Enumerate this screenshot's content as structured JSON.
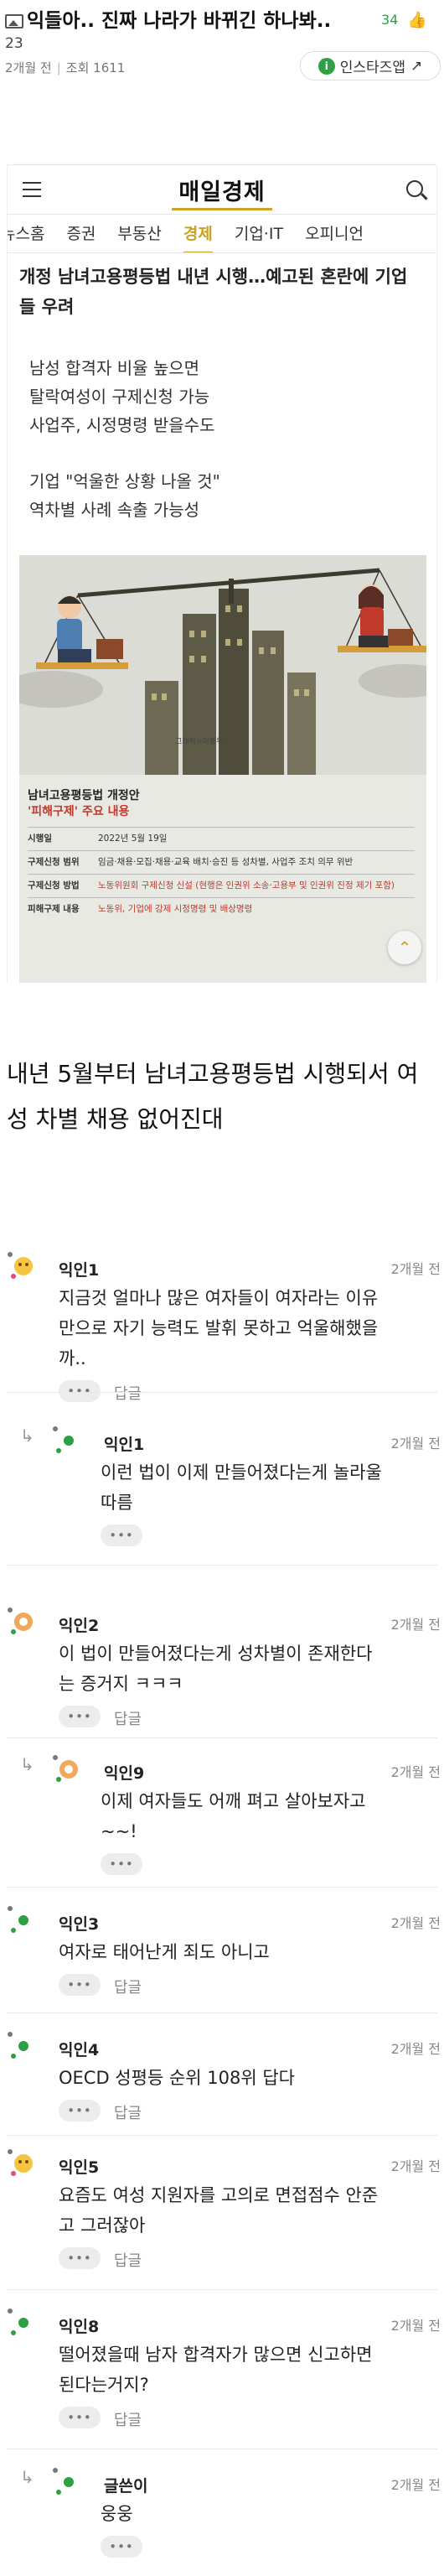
{
  "post": {
    "title": "익들아.. 진짜 나라가 바뀌긴 하나봐..",
    "like_count": "34",
    "comment_count": "23",
    "time_ago": "2개월 전",
    "views_label": "조회",
    "views": "1611",
    "insta_button": "인스타즈앱",
    "body": "내년 5월부터 남녀고용평등법 시행되서 여성 차별 채용 없어진대"
  },
  "article": {
    "logo": "매일경제",
    "nav_tabs": [
      "뉴스홈",
      "증권",
      "부동산",
      "경제",
      "기업·IT",
      "오피니언"
    ],
    "active_tab": "경제",
    "headline": "개정 남녀고용평등법 내년 시행…예고된 혼란에 기업들 우려",
    "sub1": [
      "남성 합격자 비율 높으면",
      "탈락여성이 구제신청 가능",
      "사업주, 시정명령 받을수도"
    ],
    "sub2": [
      "기업 \"억울한 상황 나올 것\"",
      "역차별 사례 속출 가능성"
    ],
    "illustration": {
      "credit": "그래픽=이충우",
      "box_title_1": "남녀고용평등법 개정안",
      "box_title_2": "'피해구제' 주요 내용",
      "rows": [
        {
          "k": "시행일",
          "v": "2022년 5월 19일"
        },
        {
          "k": "구제신청 범위",
          "v": "임금·채용·모집·채용·교육 배치·승진 등 성차별, 사업주 조치 의무 위반"
        },
        {
          "k": "구제신청 방법",
          "v": "노동위원회 구제신청 신설 (현행은 인권위 소송·고용부 및 인권위 진정 제기 포함)"
        },
        {
          "k": "피해구제 내용",
          "v": "노동위, 기업에 강제 시정명령 및 배상명령"
        }
      ]
    },
    "scroll_up_icon": "chevron-up-icon"
  },
  "comments": [
    {
      "nick": "익인1",
      "time": "2개월 전",
      "text": [
        "지금것 얼마나 많은 여자들이 여자라는 이유",
        "만으로 자기 능력도 발휘 못하고 억울해했을",
        "까.."
      ],
      "reply_label": "답글",
      "more": "•••",
      "nested": false,
      "avatar": "emoji-avatar"
    },
    {
      "nick": "익인1",
      "time": "2개월 전",
      "text": [
        "이런 법이 이제 만들어졌다는게 놀라울",
        "따름"
      ],
      "reply_label": "",
      "more": "•••",
      "nested": true,
      "avatar": "dot-avatar"
    },
    {
      "nick": "익인2",
      "time": "2개월 전",
      "text": [
        "이 법이 만들어졌다는게 성차별이 존재한다",
        "는 증거지 ㅋㅋㅋ"
      ],
      "reply_label": "답글",
      "more": "•••",
      "nested": false,
      "avatar": "ring-avatar"
    },
    {
      "nick": "익인9",
      "time": "2개월 전",
      "text": [
        "이제 여자들도 어깨 펴고 살아보자고",
        "~~!"
      ],
      "reply_label": "",
      "more": "•••",
      "nested": true,
      "avatar": "ring-avatar"
    },
    {
      "nick": "익인3",
      "time": "2개월 전",
      "text": [
        "여자로 태어난게 죄도 아니고"
      ],
      "reply_label": "답글",
      "more": "•••",
      "nested": false,
      "avatar": "dot-avatar"
    },
    {
      "nick": "익인4",
      "time": "2개월 전",
      "text": [
        "OECD 성평등 순위 108위 답다"
      ],
      "reply_label": "답글",
      "more": "•••",
      "nested": false,
      "avatar": "dot-avatar"
    },
    {
      "nick": "익인5",
      "time": "2개월 전",
      "text": [
        "요즘도 여성 지원자를 고의로 면접점수 안준",
        "고 그러잖아"
      ],
      "reply_label": "답글",
      "more": "•••",
      "nested": false,
      "avatar": "emoji-avatar"
    },
    {
      "nick": "익인8",
      "time": "2개월 전",
      "text": [
        "떨어졌을때 남자 합격자가 많으면 신고하면",
        "된다는거지?"
      ],
      "reply_label": "답글",
      "more": "•••",
      "nested": false,
      "avatar": "dot-avatar"
    },
    {
      "nick": "글쓴이",
      "time": "2개월 전",
      "text": [
        "웅웅"
      ],
      "reply_label": "",
      "more": "•••",
      "nested": true,
      "avatar": "dot-avatar"
    }
  ],
  "colors": {
    "accent_gold": "#c9a227",
    "green": "#2ea043",
    "red": "#c0392b"
  }
}
